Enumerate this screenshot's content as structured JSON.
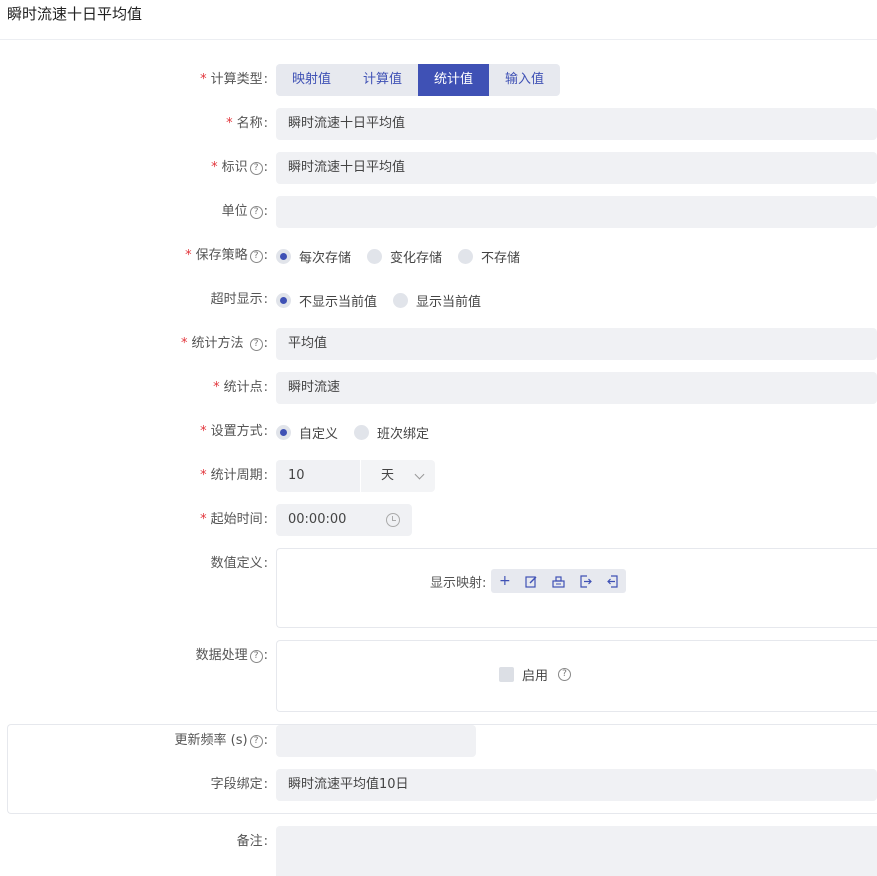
{
  "page": {
    "title": "瞬时流速十日平均值"
  },
  "form": {
    "calc_type": {
      "label": "计算类型",
      "options": [
        "映射值",
        "计算值",
        "统计值",
        "输入值"
      ],
      "selected": "统计值"
    },
    "name": {
      "label": "名称",
      "value": "瞬时流速十日平均值"
    },
    "identifier": {
      "label": "标识",
      "value": "瞬时流速十日平均值"
    },
    "unit": {
      "label": "单位",
      "value": ""
    },
    "save_strategy": {
      "label": "保存策略",
      "options": [
        "每次存储",
        "变化存储",
        "不存储"
      ],
      "selected": "每次存储"
    },
    "timeout_display": {
      "label": "超时显示",
      "options": [
        "不显示当前值",
        "显示当前值"
      ],
      "selected": "不显示当前值"
    },
    "stat_method": {
      "label": "统计方法",
      "value": "平均值"
    },
    "stat_point": {
      "label": "统计点",
      "value": "瞬时流速"
    },
    "setting_mode": {
      "label": "设置方式",
      "options": [
        "自定义",
        "班次绑定"
      ],
      "selected": "自定义"
    },
    "stat_period": {
      "label": "统计周期",
      "value": "10",
      "unit": "天"
    },
    "start_time": {
      "label": "起始时间",
      "value": "00:00:00"
    },
    "value_def": {
      "label": "数值定义",
      "mapping_label": "显示映射",
      "tools": [
        "add-icon",
        "edit-icon",
        "clear-icon",
        "import-icon",
        "export-icon"
      ]
    },
    "data_processing": {
      "label": "数据处理",
      "enable_label": "启用"
    },
    "update_freq": {
      "label": "更新频率 (s)",
      "value": ""
    },
    "field_binding": {
      "label": "字段绑定",
      "value": "瞬时流速平均值10日"
    },
    "remark": {
      "label": "备注",
      "value": ""
    }
  },
  "colors": {
    "accent": "#3f51b5",
    "required": "#e2343a",
    "input_bg": "#f0f1f4"
  }
}
